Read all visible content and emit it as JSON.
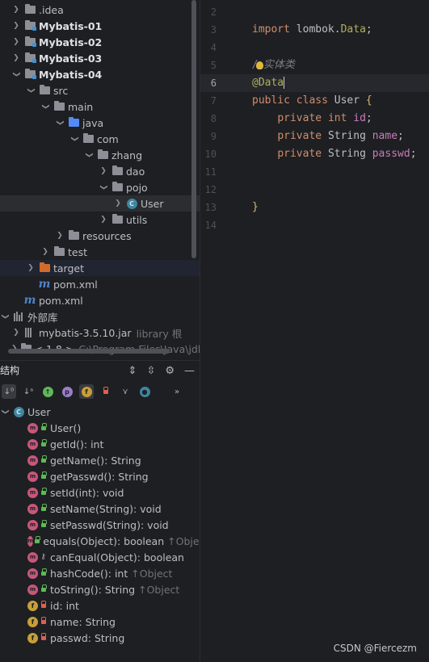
{
  "tree": {
    "items": [
      {
        "label": ".idea"
      },
      {
        "label": "Mybatis-01"
      },
      {
        "label": "Mybatis-02"
      },
      {
        "label": "Mybatis-03"
      },
      {
        "label": "Mybatis-04"
      },
      {
        "label": "src"
      },
      {
        "label": "main"
      },
      {
        "label": "java"
      },
      {
        "label": "com"
      },
      {
        "label": "zhang"
      },
      {
        "label": "dao"
      },
      {
        "label": "pojo"
      },
      {
        "label": "User"
      },
      {
        "label": "utils"
      },
      {
        "label": "resources"
      },
      {
        "label": "test"
      },
      {
        "label": "target"
      },
      {
        "label": "pom.xml"
      },
      {
        "label": "pom.xml"
      },
      {
        "label": "外部库"
      },
      {
        "label": "mybatis-3.5.10.jar",
        "extra": "library 根"
      },
      {
        "label": "< 1.8 >",
        "extra": "C:\\Program Files\\Java\\jdk"
      }
    ],
    "mybatis01": "mybatis-01",
    "mybatis02": "mybatis-02",
    "mybatis03": "mybatis-03",
    "mybatis04": "Mybatis-04"
  },
  "structure": {
    "title": "结构",
    "root": "User",
    "members": [
      {
        "label": "User()"
      },
      {
        "label": "getId(): int"
      },
      {
        "label": "getName(): String"
      },
      {
        "label": "getPasswd(): String"
      },
      {
        "label": "setId(int): void"
      },
      {
        "label": "setName(String): void"
      },
      {
        "label": "setPasswd(String): void"
      },
      {
        "label": "equals(Object): boolean",
        "inherit": "↑Object"
      },
      {
        "label": "canEqual(Object): boolean"
      },
      {
        "label": "hashCode(): int",
        "inherit": "↑Object"
      },
      {
        "label": "toString(): String",
        "inherit": "↑Object"
      },
      {
        "label": "id: int"
      },
      {
        "label": "name: String"
      },
      {
        "label": "passwd: String"
      }
    ]
  },
  "editor": {
    "line_numbers": [
      "2",
      "3",
      "4",
      "5",
      "6",
      "7",
      "8",
      "9",
      "10",
      "11",
      "12",
      "13",
      "14"
    ],
    "import_kw": "import",
    "import_pkg": "lombok.",
    "import_cls": "Data",
    "comment_a": "/",
    "comment_b": "实体类",
    "annotation": "@Data",
    "kw_public": "public",
    "kw_class": "class",
    "class_name": "User",
    "brace_open": "{",
    "kw_private": "private",
    "type_int": "int",
    "type_string": "String",
    "field_id": "id",
    "field_name": "name",
    "field_passwd": "passwd",
    "semicolon": ";",
    "brace_close": "}"
  },
  "watermark": "CSDN @Fiercezm"
}
